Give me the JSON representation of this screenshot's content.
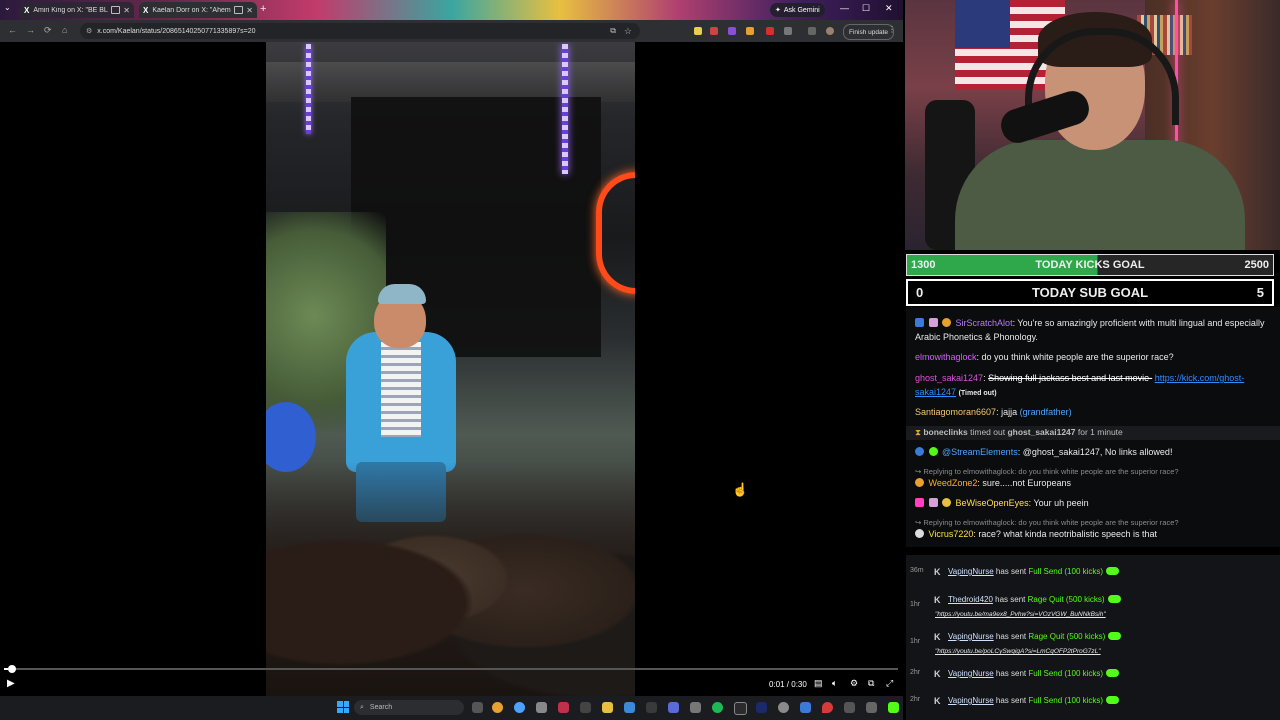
{
  "browser": {
    "tabs": [
      {
        "label": "Amiri King on X: \"BE BLACK\"",
        "active": false
      },
      {
        "label": "Kaelan Dorr on X: \"Ahem...",
        "active": true
      }
    ],
    "new_tab": "+",
    "gemini_label": "Ask Gemini",
    "window_controls": {
      "minimize": "—",
      "maximize": "☐",
      "close": "✕"
    },
    "url": "x.com/Kaelan/status/20865140250771335897s=20",
    "finish_update_label": "Finish update",
    "nav": {
      "back": "←",
      "forward": "→",
      "reload": "⟳",
      "home": "⌂"
    }
  },
  "player": {
    "current_time": "0:01",
    "duration": "0:30",
    "time_display": "0:01 / 0:30",
    "progress_fraction": 0.005,
    "play_icon": "▶"
  },
  "taskbar": {
    "search_placeholder": "Search"
  },
  "goals": {
    "kicks": {
      "current": "1300",
      "label": "TODAY KICKS GOAL",
      "target": "2500",
      "fraction": 0.52
    },
    "subs": {
      "current": "0",
      "label": "TODAY SUB GOAL",
      "target": "5"
    }
  },
  "chat": {
    "messages": [
      {
        "user": "SirScratchAlot",
        "text": "You're so amazingly proficient with multi lingual and especially Arabic Phonetics & Phonology.",
        "color": "#b57cff"
      },
      {
        "user": "elmowithaglock",
        "text": "do you think white people are the superior race?",
        "color": "#d85cff"
      },
      {
        "user": "ghost_sakai1247",
        "text": "Showing full jackass best and last movie-",
        "link": "https://kick.com/ghost-sakai1247",
        "suffix": "(Timed out)",
        "color": "#e04fd8"
      },
      {
        "user": "Santiagomoran6607",
        "text": "jajja",
        "tag": "(grandfather)",
        "color": "#f0c878"
      },
      {
        "system_user": "boneclinks",
        "system_text": "timed out",
        "system_target": "ghost_sakai1247",
        "system_suffix": "for 1 minute"
      },
      {
        "user": "@StreamElements",
        "text": "@ghost_sakai1247, No links allowed!",
        "color": "#4fa3ff"
      },
      {
        "reply": "Replying to elmowithaglock: do you think white people are the superior race?"
      },
      {
        "user": "WeedZone2",
        "text": "sure.....not Europeans",
        "color": "#ffb020"
      },
      {
        "user": "BeWiseOpenEyes",
        "text": "Your uh peein",
        "color": "#ffe040"
      },
      {
        "reply": "Replying to elmowithaglock: do you think white people are the superior race?"
      },
      {
        "user": "Vicrus7220",
        "text": "race? what kinda neotribalistic speech is that",
        "color": "#ffe040"
      }
    ]
  },
  "events": [
    {
      "ago": "36m",
      "user": "VapingNurse",
      "verb": "has sent",
      "item": "Full Send (100 kicks)"
    },
    {
      "ago": "1hr",
      "user": "Thedroid420",
      "verb": "has sent",
      "item": "Rage Quit (500 kicks)",
      "link": "\"https://youtu.be/ma9ex8_Pvhw?si=VOzVGW_BuNNkBsih\""
    },
    {
      "ago": "1hr",
      "user": "VapingNurse",
      "verb": "has sent",
      "item": "Rage Quit (500 kicks)",
      "link": "\"https://youtu.be/poLCySwqigA?si=LmCqOFP2tProG7zL\""
    },
    {
      "ago": "2hr",
      "user": "VapingNurse",
      "verb": "has sent",
      "item": "Full Send (100 kicks)"
    },
    {
      "ago": "2hr",
      "user": "VapingNurse",
      "verb": "has sent",
      "item": "Full Send (100 kicks)"
    }
  ],
  "colors": {
    "kick_green": "#53fc18",
    "goal_green": "#2ea84a",
    "link_blue": "#2f8cff"
  }
}
